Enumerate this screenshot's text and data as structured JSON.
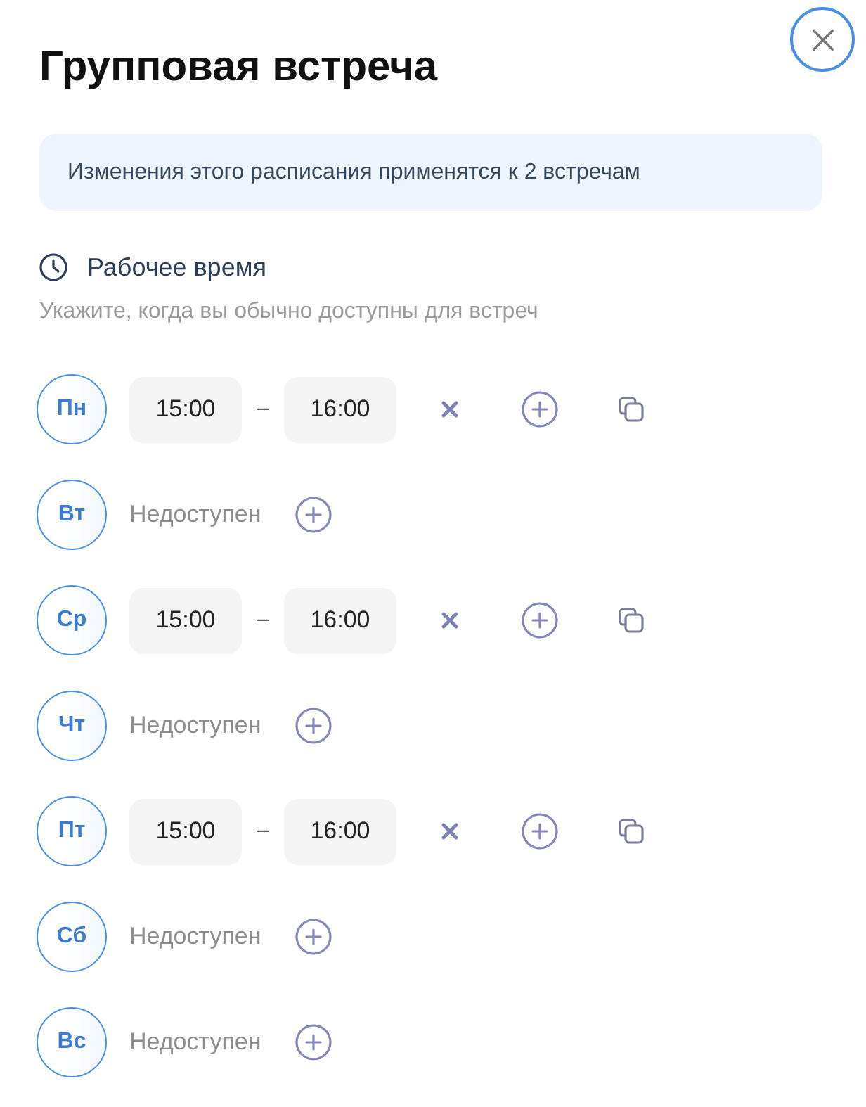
{
  "title": "Групповая встреча",
  "close_button": {
    "focused": true
  },
  "notice": "Изменения этого расписания применятся к 2 встречам",
  "section": {
    "title": "Рабочее время",
    "hint": "Укажите, когда вы обычно доступны для встреч"
  },
  "days": [
    {
      "label": "Пн",
      "available": true,
      "slots": [
        {
          "start": "15:00",
          "separator": "–",
          "end": "16:00"
        }
      ]
    },
    {
      "label": "Вт",
      "available": false,
      "status": "Недоступен"
    },
    {
      "label": "Ср",
      "available": true,
      "slots": [
        {
          "start": "15:00",
          "separator": "–",
          "end": "16:00"
        }
      ]
    },
    {
      "label": "Чт",
      "available": false,
      "status": "Недоступен"
    },
    {
      "label": "Пт",
      "available": true,
      "slots": [
        {
          "start": "15:00",
          "separator": "–",
          "end": "16:00"
        }
      ]
    },
    {
      "label": "Сб",
      "available": false,
      "status": "Недоступен"
    },
    {
      "label": "Вс",
      "available": false,
      "status": "Недоступен"
    }
  ]
}
